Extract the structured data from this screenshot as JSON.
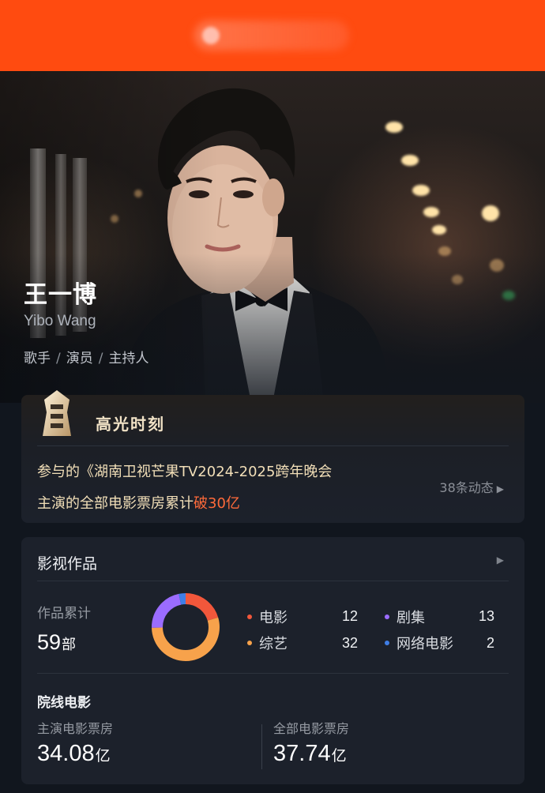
{
  "colors": {
    "topbar": "#ff4b10",
    "highlight_accent": "#ff6a3a",
    "movie": "#f2573b",
    "series": "#9b6cff",
    "variety": "#f7a24b",
    "web_movie": "#3f7ee6"
  },
  "header": {
    "logo": "blurred-logo"
  },
  "profile": {
    "name_cn": "王一博",
    "name_en": "Yibo Wang",
    "roles": [
      "歌手",
      "演员",
      "主持人"
    ],
    "role_separator": "/"
  },
  "highlight": {
    "icon": "trophy-icon",
    "title": "高光时刻",
    "line1": "参与的《湖南卫视芒果TV2024-2025跨年晚会",
    "line2_prefix": "主演的全部电影票房累计",
    "line2_highlight": "破30亿",
    "more": "38条动态",
    "more_arrow": "▶"
  },
  "works": {
    "title": "影视作品",
    "arrow": "▶",
    "total_label": "作品累计",
    "total_value": "59",
    "total_unit": "部",
    "categories": [
      {
        "label": "电影",
        "value": "12",
        "color": "#f2573b"
      },
      {
        "label": "剧集",
        "value": "13",
        "color": "#9b6cff"
      },
      {
        "label": "综艺",
        "value": "32",
        "color": "#f7a24b"
      },
      {
        "label": "网络电影",
        "value": "2",
        "color": "#3f7ee6"
      }
    ],
    "cinema_title": "院线电影",
    "lead_box_label": "主演电影票房",
    "lead_box_value": "34.08",
    "lead_box_unit": "亿",
    "all_box_label": "全部电影票房",
    "all_box_value": "37.74",
    "all_box_unit": "亿"
  }
}
